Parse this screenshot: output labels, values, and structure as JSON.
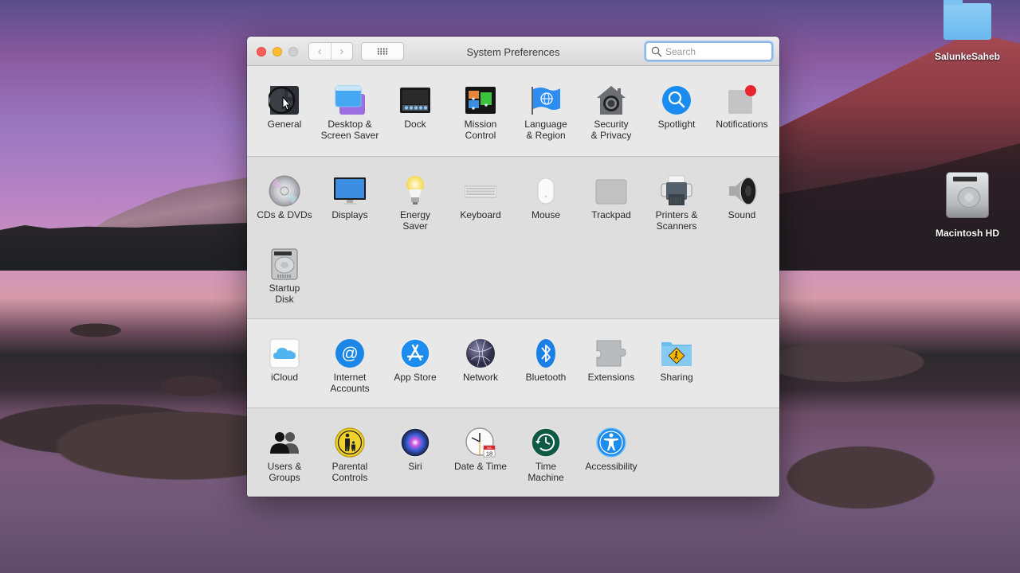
{
  "desktop": {
    "icons": [
      {
        "label": "SalunkeSaheb",
        "type": "folder"
      },
      {
        "label": "Macintosh HD",
        "type": "hard-drive"
      }
    ]
  },
  "window": {
    "title": "System Preferences",
    "back_label": "‹",
    "forward_label": "›",
    "search": {
      "placeholder": "Search",
      "value": ""
    }
  },
  "sections": [
    {
      "items": [
        {
          "label": "General",
          "icon": "general-icon"
        },
        {
          "label": "Desktop &\nScreen Saver",
          "icon": "desktop-screensaver-icon"
        },
        {
          "label": "Dock",
          "icon": "dock-icon"
        },
        {
          "label": "Mission\nControl",
          "icon": "mission-control-icon"
        },
        {
          "label": "Language\n& Region",
          "icon": "language-region-icon"
        },
        {
          "label": "Security\n& Privacy",
          "icon": "security-privacy-icon"
        },
        {
          "label": "Spotlight",
          "icon": "spotlight-icon"
        },
        {
          "label": "Notifications",
          "icon": "notifications-icon"
        }
      ]
    },
    {
      "items": [
        {
          "label": "CDs & DVDs",
          "icon": "cds-dvds-icon"
        },
        {
          "label": "Displays",
          "icon": "displays-icon"
        },
        {
          "label": "Energy\nSaver",
          "icon": "energy-saver-icon"
        },
        {
          "label": "Keyboard",
          "icon": "keyboard-icon"
        },
        {
          "label": "Mouse",
          "icon": "mouse-icon"
        },
        {
          "label": "Trackpad",
          "icon": "trackpad-icon"
        },
        {
          "label": "Printers &\nScanners",
          "icon": "printers-scanners-icon"
        },
        {
          "label": "Sound",
          "icon": "sound-icon"
        },
        {
          "label": "Startup\nDisk",
          "icon": "startup-disk-icon"
        }
      ]
    },
    {
      "items": [
        {
          "label": "iCloud",
          "icon": "icloud-icon"
        },
        {
          "label": "Internet\nAccounts",
          "icon": "internet-accounts-icon"
        },
        {
          "label": "App Store",
          "icon": "app-store-icon"
        },
        {
          "label": "Network",
          "icon": "network-icon"
        },
        {
          "label": "Bluetooth",
          "icon": "bluetooth-icon"
        },
        {
          "label": "Extensions",
          "icon": "extensions-icon"
        },
        {
          "label": "Sharing",
          "icon": "sharing-icon"
        }
      ]
    },
    {
      "items": [
        {
          "label": "Users &\nGroups",
          "icon": "users-groups-icon"
        },
        {
          "label": "Parental\nControls",
          "icon": "parental-controls-icon"
        },
        {
          "label": "Siri",
          "icon": "siri-icon"
        },
        {
          "label": "Date & Time",
          "icon": "date-time-icon"
        },
        {
          "label": "Time\nMachine",
          "icon": "time-machine-icon"
        },
        {
          "label": "Accessibility",
          "icon": "accessibility-icon"
        }
      ]
    }
  ],
  "date_time_icon": {
    "month": "JUL",
    "day": "18"
  },
  "colors": {
    "close": "#fc5f57",
    "minimize": "#fdbc2e",
    "zoom_disabled": "#cfcfcf",
    "search_focus": "#8fb8e8",
    "notification_badge": "#e8252e"
  }
}
